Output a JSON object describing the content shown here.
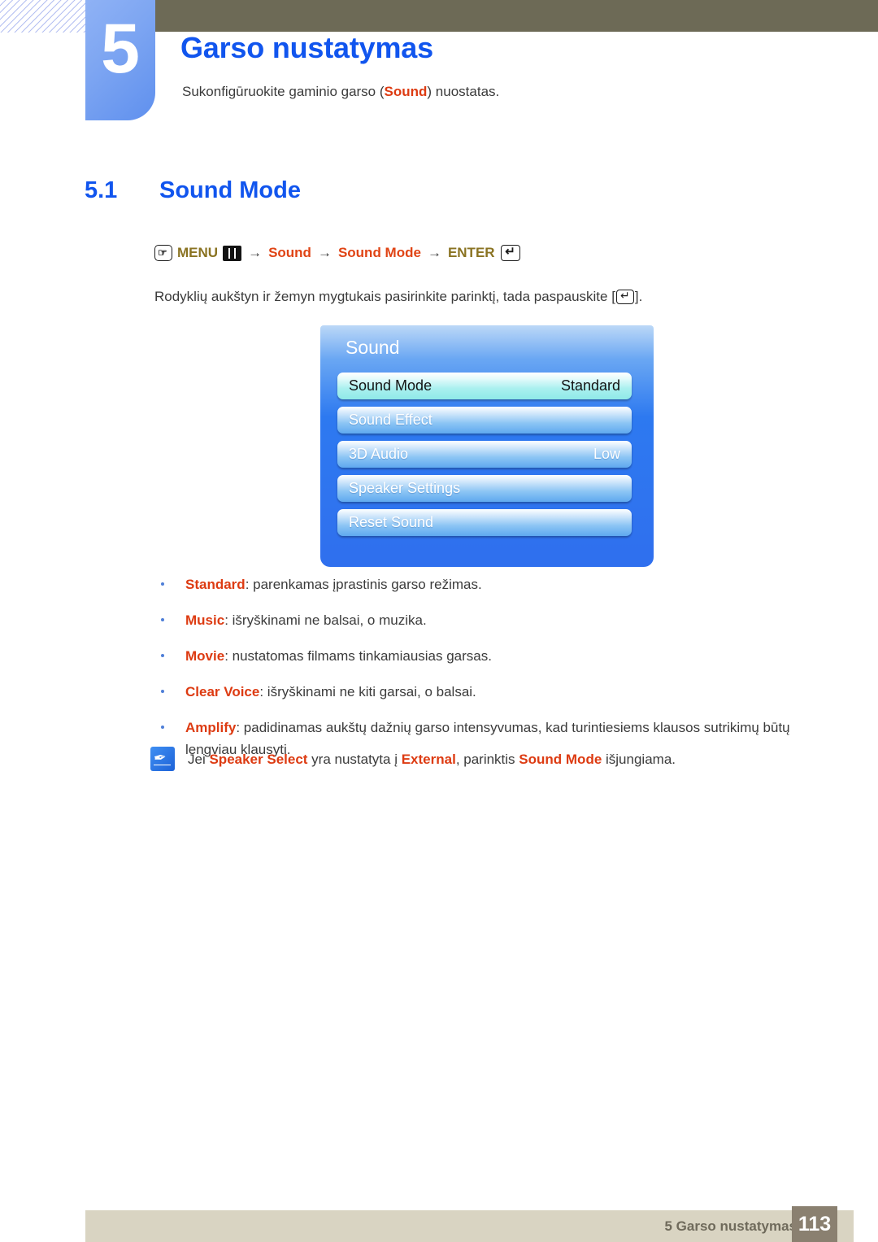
{
  "page": {
    "chapter_number": "5",
    "chapter_title": "Garso nustatymas",
    "chapter_description_before": "Sukonfigūruokite gaminio garso (",
    "chapter_description_keyword": "Sound",
    "chapter_description_after": ") nuostatas."
  },
  "section": {
    "number": "5.1",
    "title": "Sound Mode"
  },
  "menu_path": {
    "menu_label": "MENU",
    "arrow": "→",
    "item1": "Sound",
    "item2": "Sound Mode",
    "enter_label": "ENTER",
    "menu_button_icon": "hand-press-button-icon",
    "menu_bars_icon": "menu-bars-icon",
    "enter_icon": "enter-return-icon"
  },
  "instruction": {
    "before": "Rodyklių aukštyn ir žemyn mygtukais pasirinkite parinktį, tada paspauskite [",
    "after": "]."
  },
  "osd": {
    "title": "Sound",
    "rows": [
      {
        "label": "Sound Mode",
        "value": "Standard",
        "selected": true
      },
      {
        "label": "Sound Effect",
        "value": "",
        "selected": false
      },
      {
        "label": "3D Audio",
        "value": "Low",
        "selected": false
      },
      {
        "label": "Speaker Settings",
        "value": "",
        "selected": false
      },
      {
        "label": "Reset Sound",
        "value": "",
        "selected": false
      }
    ]
  },
  "bullets": [
    {
      "term": "Standard",
      "rest": ": parenkamas įprastinis garso režimas."
    },
    {
      "term": "Music",
      "rest": ": išryškinami ne balsai, o muzika."
    },
    {
      "term": "Movie",
      "rest": ": nustatomas filmams tinkamiausias garsas."
    },
    {
      "term": "Clear Voice",
      "rest": ": išryškinami ne kiti garsai, o balsai."
    },
    {
      "term": "Amplify",
      "rest": ": padidinamas aukštų dažnių garso intensyvumas, kad turintiesiems klausos sutrikimų būtų lengviau klausyti."
    }
  ],
  "note": {
    "icon": "note-quill-icon",
    "part1": "Jei ",
    "term1": "Speaker Select",
    "part2": " yra nustatyta į ",
    "term2": "External",
    "part3": ", parinktis ",
    "term3": "Sound Mode",
    "part4": " išjungiama."
  },
  "footer": {
    "label": "5 Garso nustatymas",
    "page_number": "113"
  },
  "colors": {
    "heading_blue": "#1155ee",
    "keyword_red": "#dd3b12",
    "menu_olive": "#8a7322",
    "menu_red": "#e04415",
    "olive_bar": "#6d6a56",
    "footer_beige": "#d9d4c2",
    "footer_page_box": "#8a8070",
    "osd_blue": "#2d79f0",
    "osd_selected_cyan": "#8fe9e8"
  }
}
